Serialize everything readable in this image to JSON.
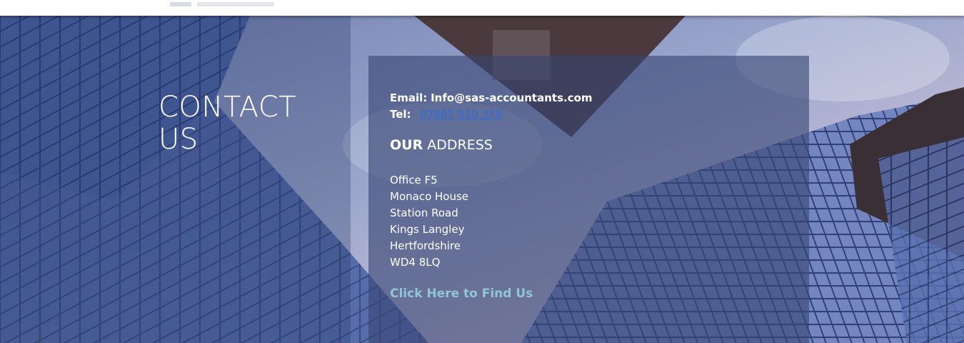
{
  "contact": {
    "heading_line1": "CONTACT",
    "heading_line2": "US"
  },
  "info": {
    "email_label": "Email:",
    "email_value": "Info@sas-accountants.com",
    "tel_label": "Tel:",
    "tel_value": "07807 910 379"
  },
  "address": {
    "heading_bold": "OUR",
    "heading_rest": "ADDRESS",
    "lines": [
      "Office F5",
      "Monaco House",
      "Station Road",
      "Kings Langley",
      "Hertfordshire",
      "WD4 8LQ"
    ],
    "find_link": "Click Here to Find Us"
  },
  "colors": {
    "link_blue": "#2a6ce0",
    "find_link": "#8fc5d6",
    "panel": "#374673",
    "sky": "#8a98c2"
  }
}
